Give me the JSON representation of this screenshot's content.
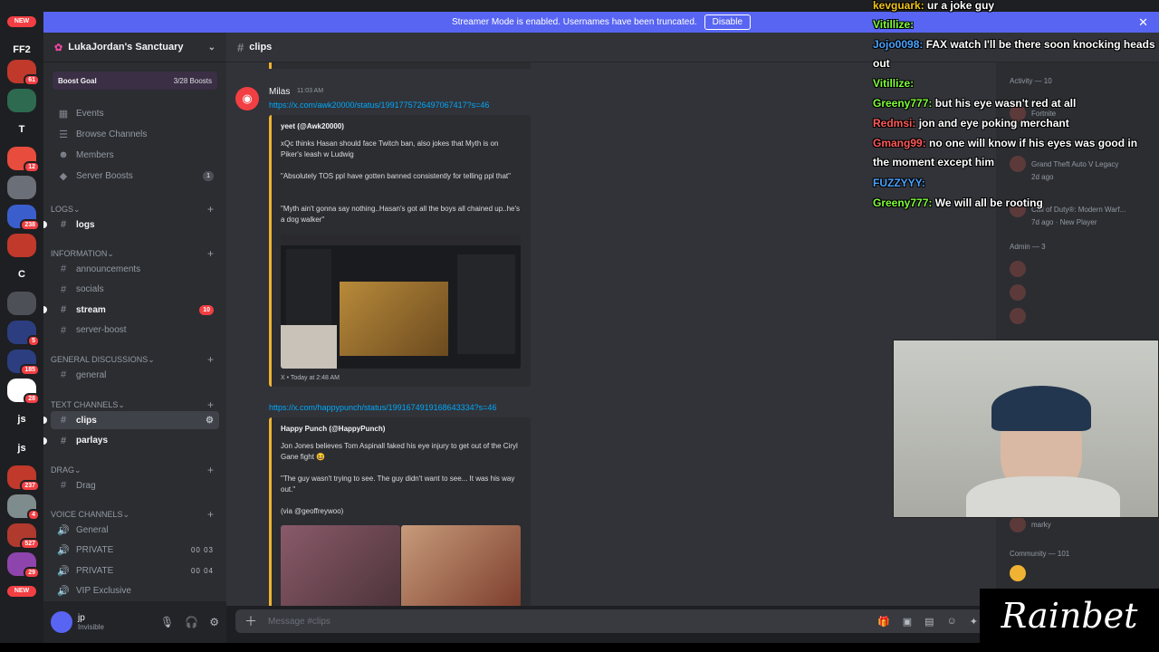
{
  "banner": {
    "text": "Streamer Mode is enabled. Usernames have been truncated.",
    "button": "Disable"
  },
  "rail": {
    "top_label": "FF2",
    "items": [
      {
        "label": "",
        "color": "#c0392b",
        "badge": "61"
      },
      {
        "label": "",
        "color": "#2d6a4f",
        "badge": ""
      },
      {
        "label": "T",
        "color": "#1e1f22",
        "badge": ""
      },
      {
        "label": "",
        "color": "#e84c3d",
        "badge": "12"
      },
      {
        "label": "",
        "color": "#6b6f78",
        "badge": ""
      },
      {
        "label": "",
        "color": "#3a5fcd",
        "badge": "238"
      },
      {
        "label": "",
        "color": "#c0392b",
        "badge": ""
      },
      {
        "label": "C",
        "color": "#1e1f22",
        "badge": ""
      },
      {
        "label": "",
        "color": "#4e5058",
        "badge": ""
      },
      {
        "label": "",
        "color": "#2c3e80",
        "badge": "5"
      },
      {
        "label": "",
        "color": "#2c3e80",
        "badge": "185"
      },
      {
        "label": "",
        "color": "#ffffff",
        "badge": "28"
      },
      {
        "label": "js",
        "color": "#1e1f22",
        "badge": ""
      },
      {
        "label": "js",
        "color": "#1e1f22",
        "badge": ""
      },
      {
        "label": "",
        "color": "#c0392b",
        "badge": "237"
      },
      {
        "label": "",
        "color": "#7f8c8d",
        "badge": "4"
      },
      {
        "label": "",
        "color": "#b03a2e",
        "badge": "527"
      },
      {
        "label": "",
        "color": "#8e44ad",
        "badge": "29"
      }
    ],
    "new_label": "NEW"
  },
  "guild": {
    "name": "LukaJordan's Sanctuary",
    "boost_goal": "Boost Goal",
    "boosts": "3/28 Boosts"
  },
  "sidebar": {
    "top_items": [
      {
        "label": "Events",
        "icon": "calendar-icon",
        "badge": ""
      },
      {
        "label": "Browse Channels",
        "icon": "browse-icon",
        "badge": ""
      },
      {
        "label": "Members",
        "icon": "members-icon",
        "badge": ""
      },
      {
        "label": "Server Boosts",
        "icon": "boost-icon",
        "badge": "1"
      }
    ],
    "categories": [
      {
        "name": "LOGS",
        "channels": [
          {
            "label": "logs",
            "bright": true,
            "badge": ""
          }
        ]
      },
      {
        "name": "INFORMATION",
        "channels": [
          {
            "label": "announcements",
            "bright": false,
            "badge": ""
          },
          {
            "label": "socials",
            "bright": false,
            "badge": ""
          },
          {
            "label": "stream",
            "bright": true,
            "badge": "10"
          },
          {
            "label": "server-boost",
            "bright": false,
            "badge": ""
          }
        ]
      },
      {
        "name": "GENERAL DISCUSSIONS",
        "channels": [
          {
            "label": "general",
            "bright": false,
            "badge": ""
          }
        ]
      },
      {
        "name": "TEXT CHANNELS",
        "channels": [
          {
            "label": "clips",
            "bright": true,
            "badge": "",
            "active": true
          },
          {
            "label": "parlays",
            "bright": true,
            "badge": ""
          }
        ]
      },
      {
        "name": "Drag",
        "channels": [
          {
            "label": "Drag",
            "bright": false,
            "badge": ""
          }
        ]
      },
      {
        "name": "Voice Channels",
        "channels": [
          {
            "label": "General",
            "bright": false,
            "voice": ""
          },
          {
            "label": "PRIVATE",
            "bright": false,
            "voice": "00 03"
          },
          {
            "label": "PRIVATE",
            "bright": false,
            "voice": "00 04"
          },
          {
            "label": "VIP Exclusive",
            "bright": false,
            "voice": ""
          }
        ]
      }
    ]
  },
  "user": {
    "name": "jp",
    "status": "Invisible"
  },
  "channel": {
    "name": "clips"
  },
  "message": {
    "author": "Milas",
    "time": "11:03 AM",
    "link1": "https://x.com/awk20000/status/1991775726497067417?s=46",
    "embed1": {
      "author": "yeet (@Awk20000)",
      "p1": "xQc thinks Hasan should face Twitch ban, also jokes that Myth is on Piker's leash w Ludwig",
      "p2": "\"Absolutely TOS ppl have gotten banned consistently for telling ppl that\"",
      "p3": "\"Myth ain't gonna say nothing..Hasan's got all the boys all chained up..he's a dog walker\"",
      "footer": "X • Today at 2:48 AM"
    },
    "link2": "https://x.com/happypunch/status/1991674919168643334?s=46",
    "embed2": {
      "author": "Happy Punch (@HappyPunch)",
      "p1": "Jon Jones believes Tom Aspinall faked his eye injury to get out of the Ciryl Gane fight 😆",
      "p2": "\"The guy wasn't trying to see. The guy didn't want to see... It was his way out.\"",
      "p3": "(via @geoffreywoo)"
    }
  },
  "composer": {
    "placeholder": "Message #clips"
  },
  "members": {
    "activity": "Activity — 10",
    "game1": "Fortnite",
    "game2": "Grand Theft Auto V Legacy",
    "game2_sub": "2d ago",
    "game3": "Call of Duty®: Modern Warf...",
    "game3_sub": "7d ago · New Player",
    "admin": "Admin — 3",
    "member_name": "marky",
    "community": "Community — 101"
  },
  "overlay": {
    "lines": [
      {
        "name": "kevguark:",
        "text": "ur a joke guy",
        "color": "#f0c419"
      },
      {
        "name": "Vitillize:",
        "text": "",
        "color": "#7fff3a"
      },
      {
        "name": "Jojo0098:",
        "text": "FAX watch I'll be there soon knocking heads out",
        "color": "#4aa3ff"
      },
      {
        "name": "Vitillize:",
        "text": "",
        "color": "#7fff3a"
      },
      {
        "name": "Greeny777:",
        "text": "but his eye wasn't red at all",
        "color": "#7fff3a"
      },
      {
        "name": "Redmsi:",
        "text": "jon and eye poking merchant",
        "color": "#ff5a5a"
      },
      {
        "name": "Gmang99:",
        "text": "no one will know if his eyes was good in the moment except him",
        "color": "#ff5a5a"
      },
      {
        "name": "FUZZYYY:",
        "text": "",
        "color": "#4aa3ff"
      },
      {
        "name": "Greeny777:",
        "text": "We will all be rooting",
        "color": "#7fff3a"
      }
    ]
  },
  "brand": {
    "text": "Rainbet"
  }
}
